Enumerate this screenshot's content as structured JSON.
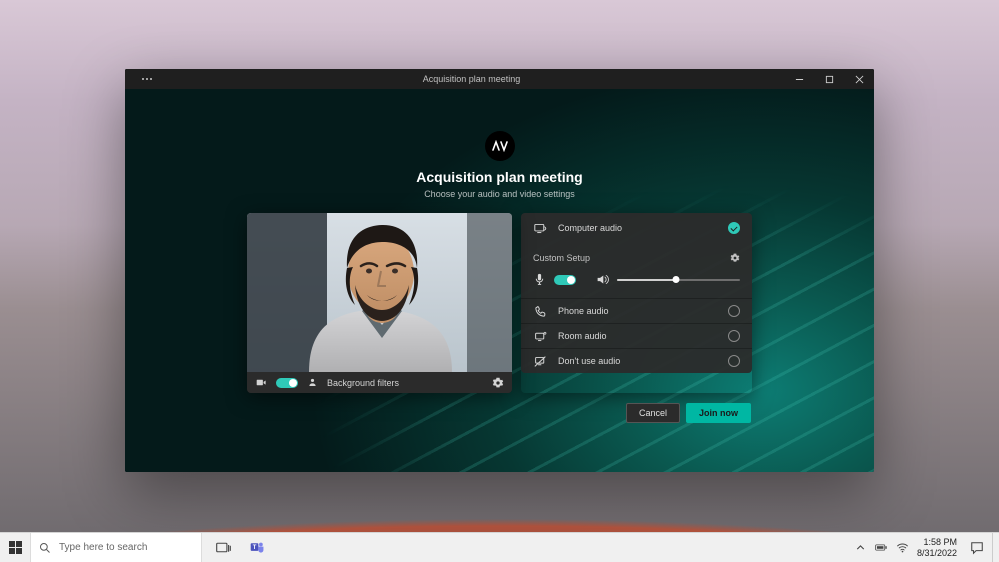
{
  "window": {
    "title": "Acquisition plan meeting"
  },
  "meeting": {
    "title": "Acquisition plan meeting",
    "subtitle": "Choose your audio and video settings",
    "logo_text": "\\/|\\"
  },
  "video": {
    "camera_on": true,
    "background_filters_label": "Background filters"
  },
  "audio": {
    "computer_audio_label": "Computer audio",
    "computer_audio_selected": true,
    "custom_setup_label": "Custom Setup",
    "mic_on": true,
    "volume_percent": 48,
    "phone_audio_label": "Phone audio",
    "room_audio_label": "Room audio",
    "dont_use_audio_label": "Don't use audio"
  },
  "buttons": {
    "cancel": "Cancel",
    "join": "Join now"
  },
  "taskbar": {
    "search_placeholder": "Type here to search",
    "time": "1:58 PM",
    "date": "8/31/2022"
  }
}
